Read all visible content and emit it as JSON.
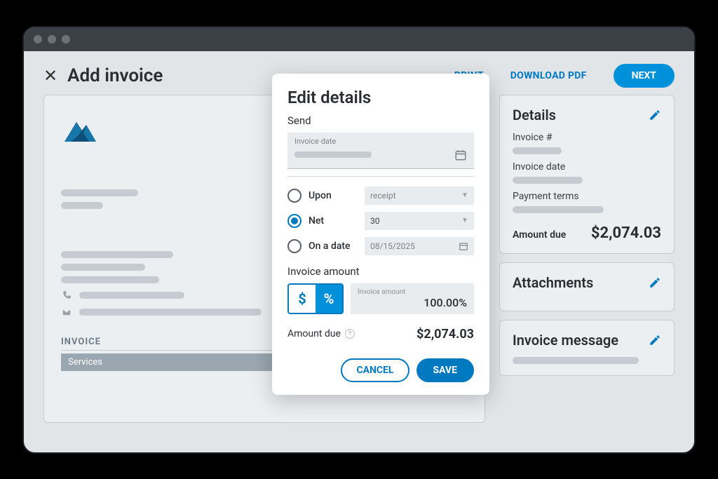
{
  "header": {
    "title": "Add invoice",
    "print": "PRINT",
    "download": "DOWNLOAD PDF",
    "next": "NEXT"
  },
  "invoice_preview": {
    "section_label": "INVOICE",
    "services_label": "Services"
  },
  "details_card": {
    "title": "Details",
    "invoice_num_label": "Invoice #",
    "invoice_date_label": "Invoice date",
    "payment_terms_label": "Payment terms",
    "amount_due_label": "Amount due",
    "amount_due_value": "$2,074.03"
  },
  "attachments_card": {
    "title": "Attachments"
  },
  "message_card": {
    "title": "Invoice message"
  },
  "modal": {
    "title": "Edit details",
    "send_label": "Send",
    "invoice_date_label": "Invoice date",
    "terms": {
      "upon_label": "Upon",
      "upon_value": "receipt",
      "net_label": "Net",
      "net_value": "30",
      "ondate_label": "On a date",
      "ondate_value": "08/15/2025"
    },
    "invoice_amount_label": "Invoice amount",
    "toggle_dollar": "$",
    "toggle_percent": "%",
    "amount_input_label": "Invoice amount",
    "amount_input_value": "100.00%",
    "amount_due_label": "Amount due",
    "amount_due_value": "$2,074.03",
    "cancel": "CANCEL",
    "save": "SAVE"
  }
}
